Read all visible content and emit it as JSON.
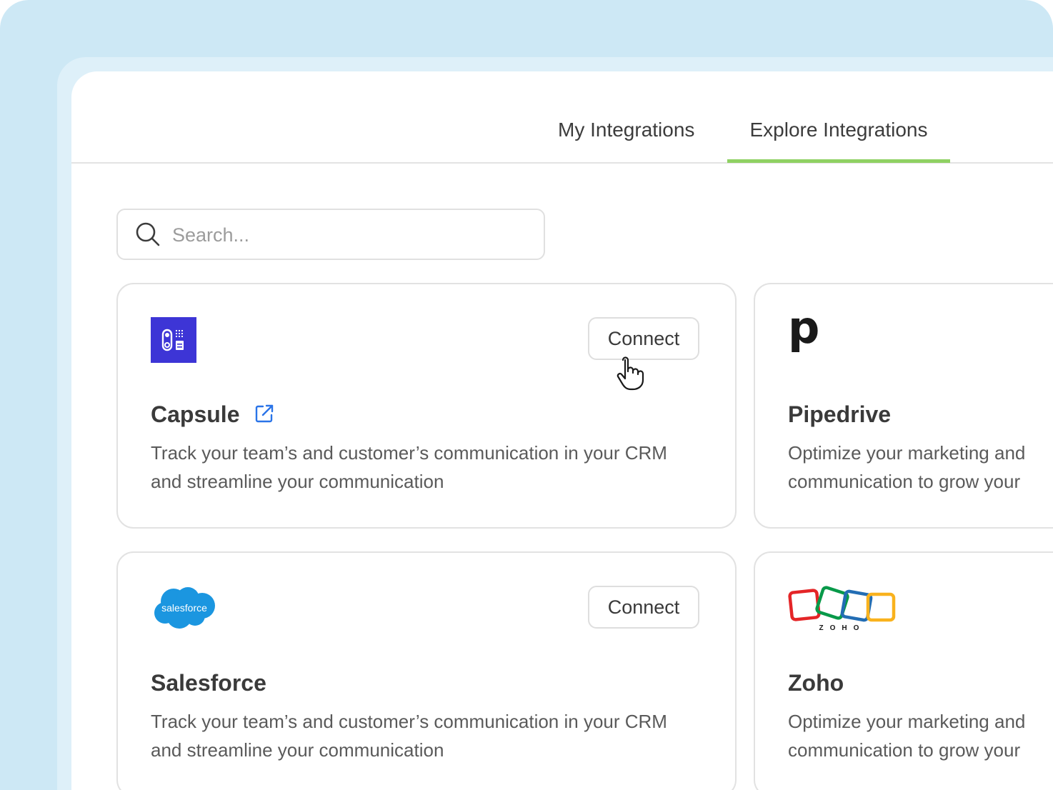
{
  "tabs": {
    "my_integrations": "My Integrations",
    "explore_integrations": "Explore Integrations",
    "active": "explore_integrations",
    "active_color": "#8fd163"
  },
  "search": {
    "placeholder": "Search...",
    "value": "",
    "icon": "search-icon"
  },
  "cards": [
    {
      "name": "Capsule",
      "description": "Track your team’s and customer’s communication in your CRM and streamline your communication",
      "button": "Connect",
      "logo": "capsule-logo",
      "logo_color": "#3d35d6",
      "external_link": true
    },
    {
      "name": "Pipedrive",
      "description_line1": "Optimize your marketing and",
      "description_line2": "communication to grow your",
      "logo": "pipedrive-logo",
      "logo_letter": "p"
    },
    {
      "name": "Salesforce",
      "description": "Track your team’s and customer’s communication in your CRM and streamline your communication",
      "button": "Connect",
      "logo": "salesforce-logo",
      "logo_text": "salesforce",
      "logo_color": "#1b96e0"
    },
    {
      "name": "Zoho",
      "description_line1": "Optimize your marketing and",
      "description_line2": "communication to grow your",
      "logo": "zoho-logo",
      "logo_text": "ZOHO"
    }
  ],
  "colors": {
    "outer_bg": "#cde8f5",
    "inner_bg": "#def0f9",
    "link_icon": "#2a74e8"
  }
}
